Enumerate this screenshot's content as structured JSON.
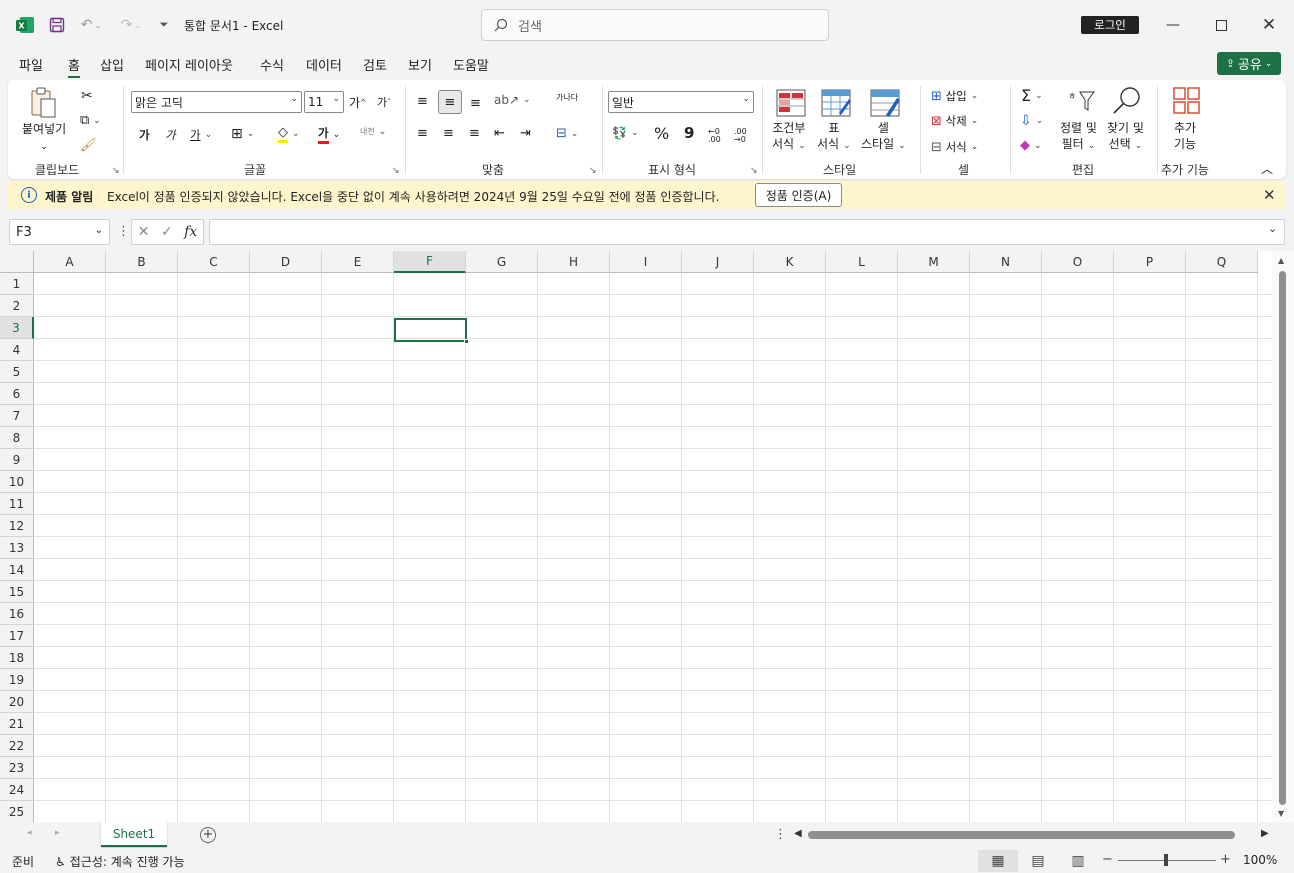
{
  "titlebar": {
    "doc_title": "통합 문서1  -  Excel",
    "search_placeholder": "검색",
    "login": "로그인"
  },
  "tabs": [
    "파일",
    "홈",
    "삽입",
    "페이지 레이아웃",
    "수식",
    "데이터",
    "검토",
    "보기",
    "도움말"
  ],
  "share": "공유",
  "ribbon": {
    "clipboard": {
      "paste": "붙여넣기",
      "label": "클립보드"
    },
    "font": {
      "name": "맑은 고딕",
      "size": "11",
      "bold": "가",
      "italic": "가",
      "underline": "가",
      "font_color": "가",
      "label": "글꼴",
      "grow": "가",
      "shrink": "가",
      "phonetic": "내천"
    },
    "align": {
      "label": "맞춤",
      "wrap": "가나다"
    },
    "number": {
      "format": "일반",
      "label": "표시 형식",
      "percent": "%",
      "comma": "9",
      "inc": "←0 .00",
      "dec": ".00 →0"
    },
    "styles": {
      "cond_1": "조건부",
      "cond_2": "서식",
      "table_1": "표",
      "table_2": "서식",
      "cell_1": "셀",
      "cell_2": "스타일",
      "label": "스타일"
    },
    "cells": {
      "insert": "삽입",
      "delete": "삭제",
      "format": "서식",
      "label": "셀"
    },
    "editing": {
      "sort_1": "정렬 및",
      "sort_2": "필터",
      "find_1": "찾기 및",
      "find_2": "선택",
      "label": "편집"
    },
    "addins": {
      "l1": "추가",
      "l2": "기능",
      "label": "추가 기능"
    }
  },
  "notice": {
    "title": "제품 알림",
    "message": "Excel이 정품 인증되지 않았습니다. Excel을 중단 없이 계속 사용하려면 2024년 9월 25일 수요일 전에 정품 인증합니다.",
    "button": "정품 인증(A)"
  },
  "formula_bar": {
    "name_box": "F3",
    "fx": "fx",
    "value": ""
  },
  "columns": [
    "A",
    "B",
    "C",
    "D",
    "E",
    "F",
    "G",
    "H",
    "I",
    "J",
    "K",
    "L",
    "M",
    "N",
    "O",
    "P",
    "Q"
  ],
  "rows": [
    "1",
    "2",
    "3",
    "4",
    "5",
    "6",
    "7",
    "8",
    "9",
    "10",
    "11",
    "12",
    "13",
    "14",
    "15",
    "16",
    "17",
    "18",
    "19",
    "20",
    "21",
    "22",
    "23",
    "24",
    "25"
  ],
  "selected": {
    "column": "F",
    "row": "3"
  },
  "sheet": {
    "name": "Sheet1"
  },
  "status": {
    "ready": "준비",
    "accessibility": "접근성: 계속 진행 가능",
    "zoom": "100%"
  },
  "colors": {
    "accent": "#1e7145",
    "notice_bg": "#fff5cc"
  }
}
